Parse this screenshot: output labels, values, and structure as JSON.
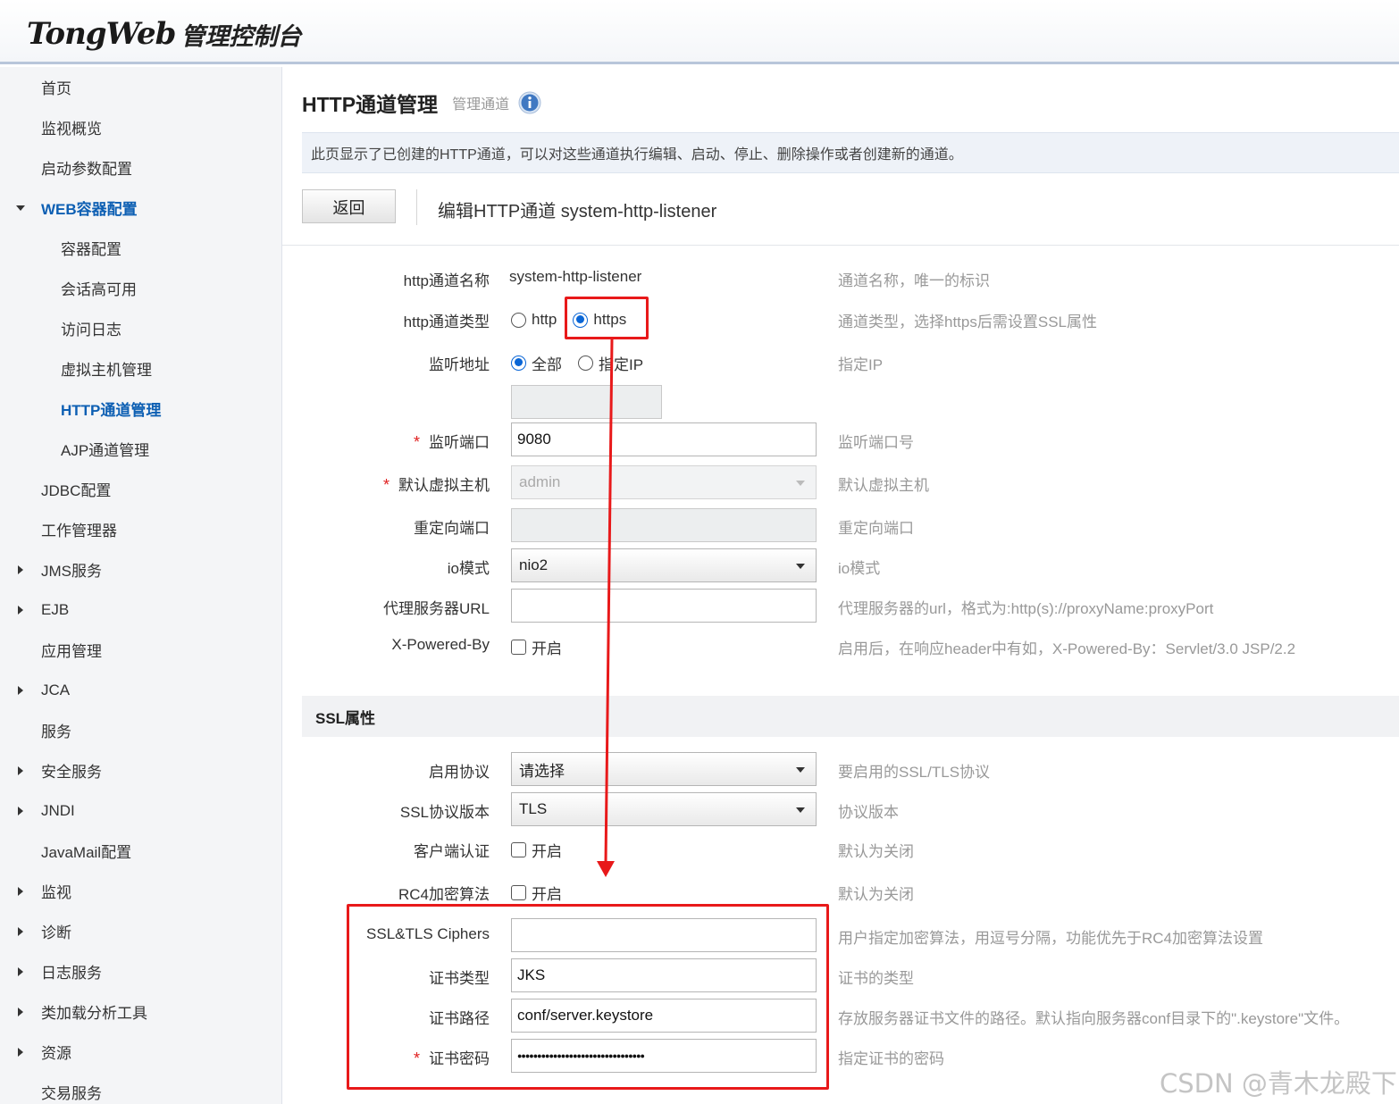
{
  "header": {
    "brand": "TongWeb",
    "suffix": "管理控制台"
  },
  "sidebar": {
    "items": [
      {
        "label": "首页",
        "arrow": "none",
        "level": 0
      },
      {
        "label": "监视概览",
        "arrow": "none",
        "level": 0
      },
      {
        "label": "启动参数配置",
        "arrow": "none",
        "level": 0
      },
      {
        "label": "WEB容器配置",
        "arrow": "down",
        "level": 0,
        "active": true
      },
      {
        "label": "容器配置",
        "arrow": "none",
        "level": 1
      },
      {
        "label": "会话高可用",
        "arrow": "none",
        "level": 1
      },
      {
        "label": "访问日志",
        "arrow": "none",
        "level": 1
      },
      {
        "label": "虚拟主机管理",
        "arrow": "none",
        "level": 1
      },
      {
        "label": "HTTP通道管理",
        "arrow": "none",
        "level": 1,
        "active": true
      },
      {
        "label": "AJP通道管理",
        "arrow": "none",
        "level": 1
      },
      {
        "label": "JDBC配置",
        "arrow": "none",
        "level": 0
      },
      {
        "label": "工作管理器",
        "arrow": "none",
        "level": 0
      },
      {
        "label": "JMS服务",
        "arrow": "right",
        "level": 0
      },
      {
        "label": "EJB",
        "arrow": "right",
        "level": 0
      },
      {
        "label": "应用管理",
        "arrow": "none",
        "level": 0
      },
      {
        "label": "JCA",
        "arrow": "right",
        "level": 0
      },
      {
        "label": "服务",
        "arrow": "none",
        "level": 0
      },
      {
        "label": "安全服务",
        "arrow": "right",
        "level": 0
      },
      {
        "label": "JNDI",
        "arrow": "right",
        "level": 0
      },
      {
        "label": "JavaMail配置",
        "arrow": "none",
        "level": 0
      },
      {
        "label": "监视",
        "arrow": "right",
        "level": 0
      },
      {
        "label": "诊断",
        "arrow": "right",
        "level": 0
      },
      {
        "label": "日志服务",
        "arrow": "right",
        "level": 0
      },
      {
        "label": "类加载分析工具",
        "arrow": "right",
        "level": 0
      },
      {
        "label": "资源",
        "arrow": "right",
        "level": 0
      },
      {
        "label": "交易服务",
        "arrow": "none",
        "level": 0
      }
    ]
  },
  "main": {
    "title": "HTTP通道管理",
    "subtitle": "管理通道",
    "description": "此页显示了已创建的HTTP通道，可以对这些通道执行编辑、启动、停止、删除操作或者创建新的通道。",
    "back_label": "返回",
    "edit_title": "编辑HTTP通道 system-http-listener"
  },
  "form": {
    "name": {
      "label": "http通道名称",
      "value": "system-http-listener",
      "hint": "通道名称，唯一的标识"
    },
    "type": {
      "label": "http通道类型",
      "opt_http": "http",
      "opt_https": "https",
      "selected": "https",
      "hint": "通道类型，选择https后需设置SSL属性"
    },
    "listen": {
      "label": "监听地址",
      "opt_all": "全部",
      "opt_ip": "指定IP",
      "selected": "全部",
      "ip_value": "",
      "hint": "指定IP"
    },
    "port": {
      "label": "监听端口",
      "value": "9080",
      "hint": "监听端口号",
      "required": true
    },
    "vhost": {
      "label": "默认虚拟主机",
      "value": "admin",
      "hint": "默认虚拟主机",
      "required": true
    },
    "redirect": {
      "label": "重定向端口",
      "value": "",
      "hint": "重定向端口"
    },
    "io": {
      "label": "io模式",
      "value": "nio2",
      "hint": "io模式"
    },
    "proxy": {
      "label": "代理服务器URL",
      "value": "",
      "hint": "代理服务器的url，格式为:http(s)://proxyName:proxyPort"
    },
    "xpowered": {
      "label": "X-Powered-By",
      "check_label": "开启",
      "checked": false,
      "hint": "启用后，在响应header中有如，X-Powered-By：Servlet/3.0 JSP/2.2"
    }
  },
  "ssl": {
    "section_title": "SSL属性",
    "protocol": {
      "label": "启用协议",
      "value": "请选择",
      "hint": "要启用的SSL/TLS协议"
    },
    "version": {
      "label": "SSL协议版本",
      "value": "TLS",
      "hint": "协议版本"
    },
    "client_auth": {
      "label": "客户端认证",
      "check_label": "开启",
      "checked": false,
      "hint": "默认为关闭"
    },
    "rc4": {
      "label": "RC4加密算法",
      "check_label": "开启",
      "checked": false,
      "hint": "默认为关闭"
    },
    "ciphers": {
      "label": "SSL&TLS Ciphers",
      "value": "",
      "hint": "用户指定加密算法，用逗号分隔，功能优先于RC4加密算法设置"
    },
    "cert_type": {
      "label": "证书类型",
      "value": "JKS",
      "hint": "证书的类型"
    },
    "cert_path": {
      "label": "证书路径",
      "value": "conf/server.keystore",
      "hint": "存放服务器证书文件的路径。默认指向服务器conf目录下的\".keystore\"文件。"
    },
    "cert_pass": {
      "label": "证书密码",
      "value": "●●●●●●●●●●●●●●●●●●●●●●●●●●●●●●●●",
      "hint": "指定证书的密码",
      "required": true
    }
  },
  "colors": {
    "accent": "#0d5fb3",
    "annotation": "#e8191a",
    "required": "#e02020"
  },
  "watermark": "CSDN @青木龙殿下"
}
